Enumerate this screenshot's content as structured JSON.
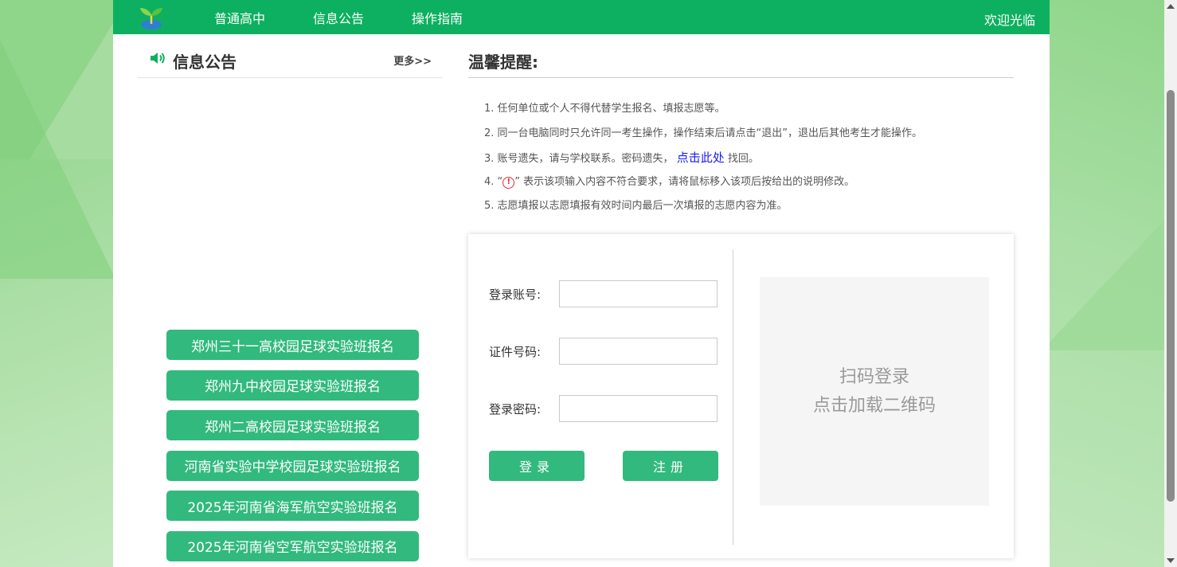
{
  "nav": {
    "items": [
      "普通高中",
      "信息公告",
      "操作指南"
    ],
    "welcome": "欢迎光临"
  },
  "notice": {
    "title": "信息公告",
    "more": "更多>>",
    "buttons": [
      "郑州三十一高校园足球实验班报名",
      "郑州九中校园足球实验班报名",
      "郑州二高校园足球实验班报名",
      "河南省实验中学校园足球实验班报名",
      "2025年河南省海军航空实验班报名",
      "2025年河南省空军航空实验班报名"
    ]
  },
  "reminder": {
    "title": "温馨提醒:",
    "tips": {
      "t1": "1. 任何单位或个人不得代替学生报名、填报志愿等。",
      "t2": "2. 同一台电脑同时只允许同一考生操作，操作结束后请点击“退出”，退出后其他考生才能操作。",
      "t3_pre": "3. 账号遗失，请与学校联系。密码遗失，",
      "t3_link": "点击此处",
      "t3_post": "找回。",
      "t4_pre": "4. “",
      "t4_icon": "!",
      "t4_post": "” 表示该项输入内容不符合要求，请将鼠标移入该项后按给出的说明修改。",
      "t5": "5. 志愿填报以志愿填报有效时间内最后一次填报的志愿内容为准。"
    }
  },
  "login": {
    "account_label": "登录账号:",
    "account_value": "",
    "id_label": "证件号码:",
    "id_value": "",
    "password_label": "登录密码:",
    "password_value": "",
    "login_button": "登录",
    "register_button": "注册",
    "qr_line1": "扫码登录",
    "qr_line2": "点击加载二维码"
  },
  "colors": {
    "nav_green": "#0db060",
    "button_green": "#32b97e",
    "link_blue": "#1a1aff",
    "warn_red": "#e02a2a"
  }
}
